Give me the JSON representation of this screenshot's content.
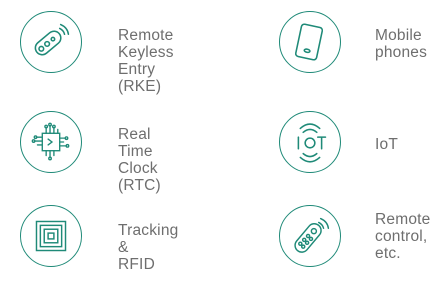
{
  "colors": {
    "accent": "#1f8a78",
    "text": "#6e6e6e"
  },
  "items": [
    {
      "icon": "key-fob-icon",
      "label": "Remote Keyless\nEntry (RKE)"
    },
    {
      "icon": "mobile-phone-icon",
      "label": "Mobile\nphones"
    },
    {
      "icon": "chip-icon",
      "label": "Real Time Clock\n(RTC)"
    },
    {
      "icon": "iot-icon",
      "label": "IoT"
    },
    {
      "icon": "rfid-tag-icon",
      "label": "Tracking &\nRFID"
    },
    {
      "icon": "remote-control-icon",
      "label": "Remote\ncontrol,\netc."
    }
  ]
}
